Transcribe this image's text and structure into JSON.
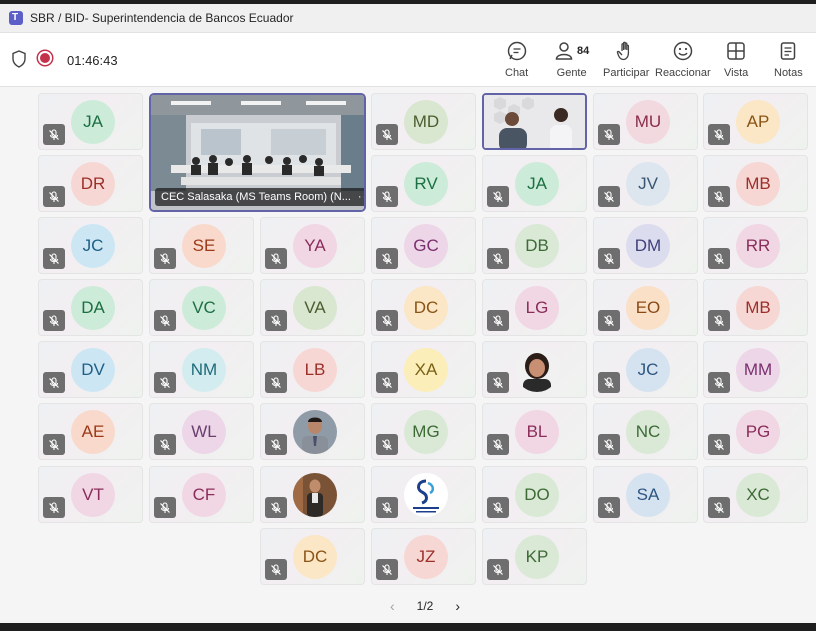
{
  "window": {
    "title": "SBR / BID- Superintendencia de Bancos Ecuador"
  },
  "toolbar": {
    "timer": "01:46:43",
    "people_count": "84",
    "buttons": {
      "chat": "Chat",
      "people": "Gente",
      "raise": "Participar",
      "react": "Reaccionar",
      "view": "Vista",
      "notes": "Notas"
    }
  },
  "room": {
    "label": "CEC Salasaka (MS Teams Room) (N..."
  },
  "pager": {
    "label": "1/2"
  },
  "participants": [
    {
      "initials": "JA",
      "bg": "#cdebd9",
      "fg": "#1b6f43"
    },
    {
      "initials": "MD",
      "bg": "#d9e6d0",
      "fg": "#4b5d2e"
    },
    {
      "initials": "MU",
      "bg": "#f2d8df",
      "fg": "#8a2d4a"
    },
    {
      "initials": "AP",
      "bg": "#fbe6c5",
      "fg": "#8a5416"
    },
    {
      "initials": "DR",
      "bg": "#f6d7d3",
      "fg": "#9c2f2a"
    },
    {
      "initials": "RV",
      "bg": "#cdebd9",
      "fg": "#1b6f43"
    },
    {
      "initials": "JA",
      "bg": "#cdebd9",
      "fg": "#1b6f43"
    },
    {
      "initials": "JV",
      "bg": "#dde6ef",
      "fg": "#3a5570"
    },
    {
      "initials": "MB",
      "bg": "#f6d7d3",
      "fg": "#9c2f2a"
    },
    {
      "initials": "JC",
      "bg": "#cde6f4",
      "fg": "#1e5f86"
    },
    {
      "initials": "SE",
      "bg": "#f9d9cc",
      "fg": "#9a3a18"
    },
    {
      "initials": "YA",
      "bg": "#f1d6e4",
      "fg": "#8a2d5a"
    },
    {
      "initials": "GC",
      "bg": "#ecd6e8",
      "fg": "#7a2f6e"
    },
    {
      "initials": "DB",
      "bg": "#d9e9d6",
      "fg": "#3d6a35"
    },
    {
      "initials": "DM",
      "bg": "#dcdcef",
      "fg": "#3f3f7a"
    },
    {
      "initials": "RR",
      "bg": "#f1d6e4",
      "fg": "#8a2d5a"
    },
    {
      "initials": "DA",
      "bg": "#cdebd9",
      "fg": "#1b6f43"
    },
    {
      "initials": "VC",
      "bg": "#cdebd9",
      "fg": "#1b6f43"
    },
    {
      "initials": "VA",
      "bg": "#d9e6d0",
      "fg": "#4b5d2e"
    },
    {
      "initials": "DC",
      "bg": "#fbe6c5",
      "fg": "#8a5416"
    },
    {
      "initials": "LG",
      "bg": "#f1d6e4",
      "fg": "#8a2d5a"
    },
    {
      "initials": "EO",
      "bg": "#fbe0c8",
      "fg": "#8a4a16"
    },
    {
      "initials": "MB",
      "bg": "#f6d7d3",
      "fg": "#9c2f2a"
    },
    {
      "initials": "DV",
      "bg": "#cde6f4",
      "fg": "#1e5f86"
    },
    {
      "initials": "NM",
      "bg": "#d3ecf0",
      "fg": "#1f6b7a"
    },
    {
      "initials": "LB",
      "bg": "#f6d7d3",
      "fg": "#9c2f2a"
    },
    {
      "initials": "XA",
      "bg": "#fbeeb8",
      "fg": "#7a6116"
    },
    {
      "initials": "JC",
      "bg": "#d5e3f1",
      "fg": "#2d5580"
    },
    {
      "initials": "MM",
      "bg": "#ecd6e8",
      "fg": "#7a2f6e"
    },
    {
      "initials": "AE",
      "bg": "#f9d9cc",
      "fg": "#9a3a18"
    },
    {
      "initials": "WL",
      "bg": "#ecd6e8",
      "fg": "#6a3f6e"
    },
    {
      "initials": "MG",
      "bg": "#d9e9d6",
      "fg": "#3d6a35"
    },
    {
      "initials": "BL",
      "bg": "#f1d6e4",
      "fg": "#8a2d5a"
    },
    {
      "initials": "NC",
      "bg": "#d9e9d6",
      "fg": "#3d6a35"
    },
    {
      "initials": "PG",
      "bg": "#f1d6e4",
      "fg": "#8a2d5a"
    },
    {
      "initials": "VT",
      "bg": "#f1d6e4",
      "fg": "#8a2d5a"
    },
    {
      "initials": "CF",
      "bg": "#f1d6e4",
      "fg": "#8a2d5a"
    },
    {
      "initials": "DO",
      "bg": "#d9e9d6",
      "fg": "#3d6a35"
    },
    {
      "initials": "SA",
      "bg": "#d5e3f1",
      "fg": "#2d5580"
    },
    {
      "initials": "XC",
      "bg": "#d9e9d6",
      "fg": "#3d6a35"
    },
    {
      "initials": "DC",
      "bg": "#fbe6c5",
      "fg": "#8a5416"
    },
    {
      "initials": "JZ",
      "bg": "#f6d7d3",
      "fg": "#9c2f2a"
    },
    {
      "initials": "KP",
      "bg": "#d9e9d6",
      "fg": "#3d6a35"
    }
  ]
}
